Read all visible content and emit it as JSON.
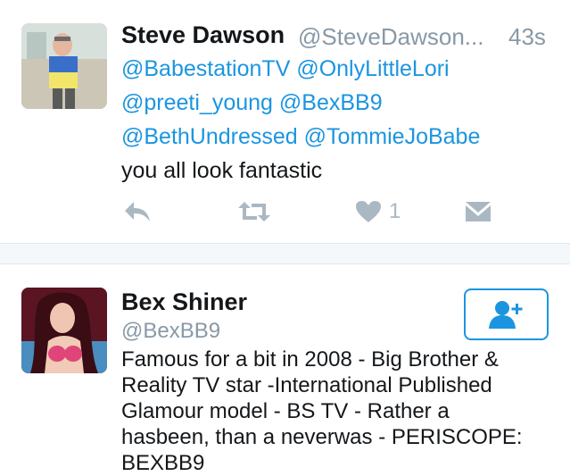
{
  "tweet": {
    "author_name": "Steve Dawson",
    "author_handle": "@SteveDawson...",
    "time": "43s",
    "mentions_line1": [
      "@BabestationTV",
      "@OnlyLittleLori"
    ],
    "mentions_line2": [
      "@preeti_young",
      "@BexBB9"
    ],
    "mentions_line3": [
      "@BethUndressed",
      "@TommieJoBabe"
    ],
    "text": "you all look fantastic",
    "like_count": "1",
    "icons": [
      "reply-icon",
      "retweet-icon",
      "heart-icon",
      "dm-icon"
    ]
  },
  "profile": {
    "name": "Bex Shiner",
    "handle": "@BexBB9",
    "bio_lines": [
      "Famous for a bit in 2008 - Big Brother &",
      "Reality TV star -International Published",
      "Glamour model - BS TV - Rather a",
      "hasbeen, than a neverwas - PERISCOPE:",
      "BEXBB9"
    ],
    "follow_icon": "add-user-icon"
  },
  "colors": {
    "accent": "#1b95e0",
    "muted": "#8899a6",
    "icon": "#aab8c2",
    "text": "#14171a",
    "divider_bg": "#f5f8fa"
  }
}
